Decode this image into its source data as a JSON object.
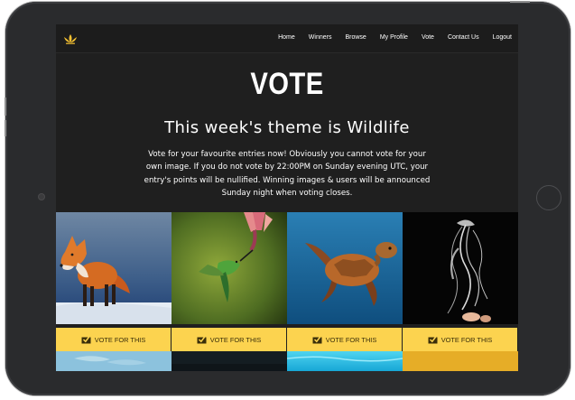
{
  "nav": {
    "links": [
      "Home",
      "Winners",
      "Browse",
      "My Profile",
      "Vote",
      "Contact Us",
      "Logout"
    ]
  },
  "hero": {
    "title": "VOTE",
    "theme": "This week's theme is Wildlife",
    "intro": "Vote for your favourite entries now! Obviously you cannot vote for your own image. If you do not vote by 22:00PM on Sunday evening UTC, your entry's points will be nullified. Winning images & users will be announced Sunday night when voting closes."
  },
  "entries": [
    {
      "subject": "fox",
      "vote_label": "VOTE FOR THIS"
    },
    {
      "subject": "hummingbird",
      "vote_label": "VOTE FOR THIS"
    },
    {
      "subject": "sea-turtle",
      "vote_label": "VOTE FOR THIS"
    },
    {
      "subject": "jellyfish",
      "vote_label": "VOTE FOR THIS"
    }
  ],
  "colors": {
    "background": "#1f1f1f",
    "vote_button": "#fcd34f",
    "logo": "#f5c132"
  },
  "icons": {
    "logo": "lotus-logo-icon",
    "vote": "vote-checkbox-icon"
  }
}
